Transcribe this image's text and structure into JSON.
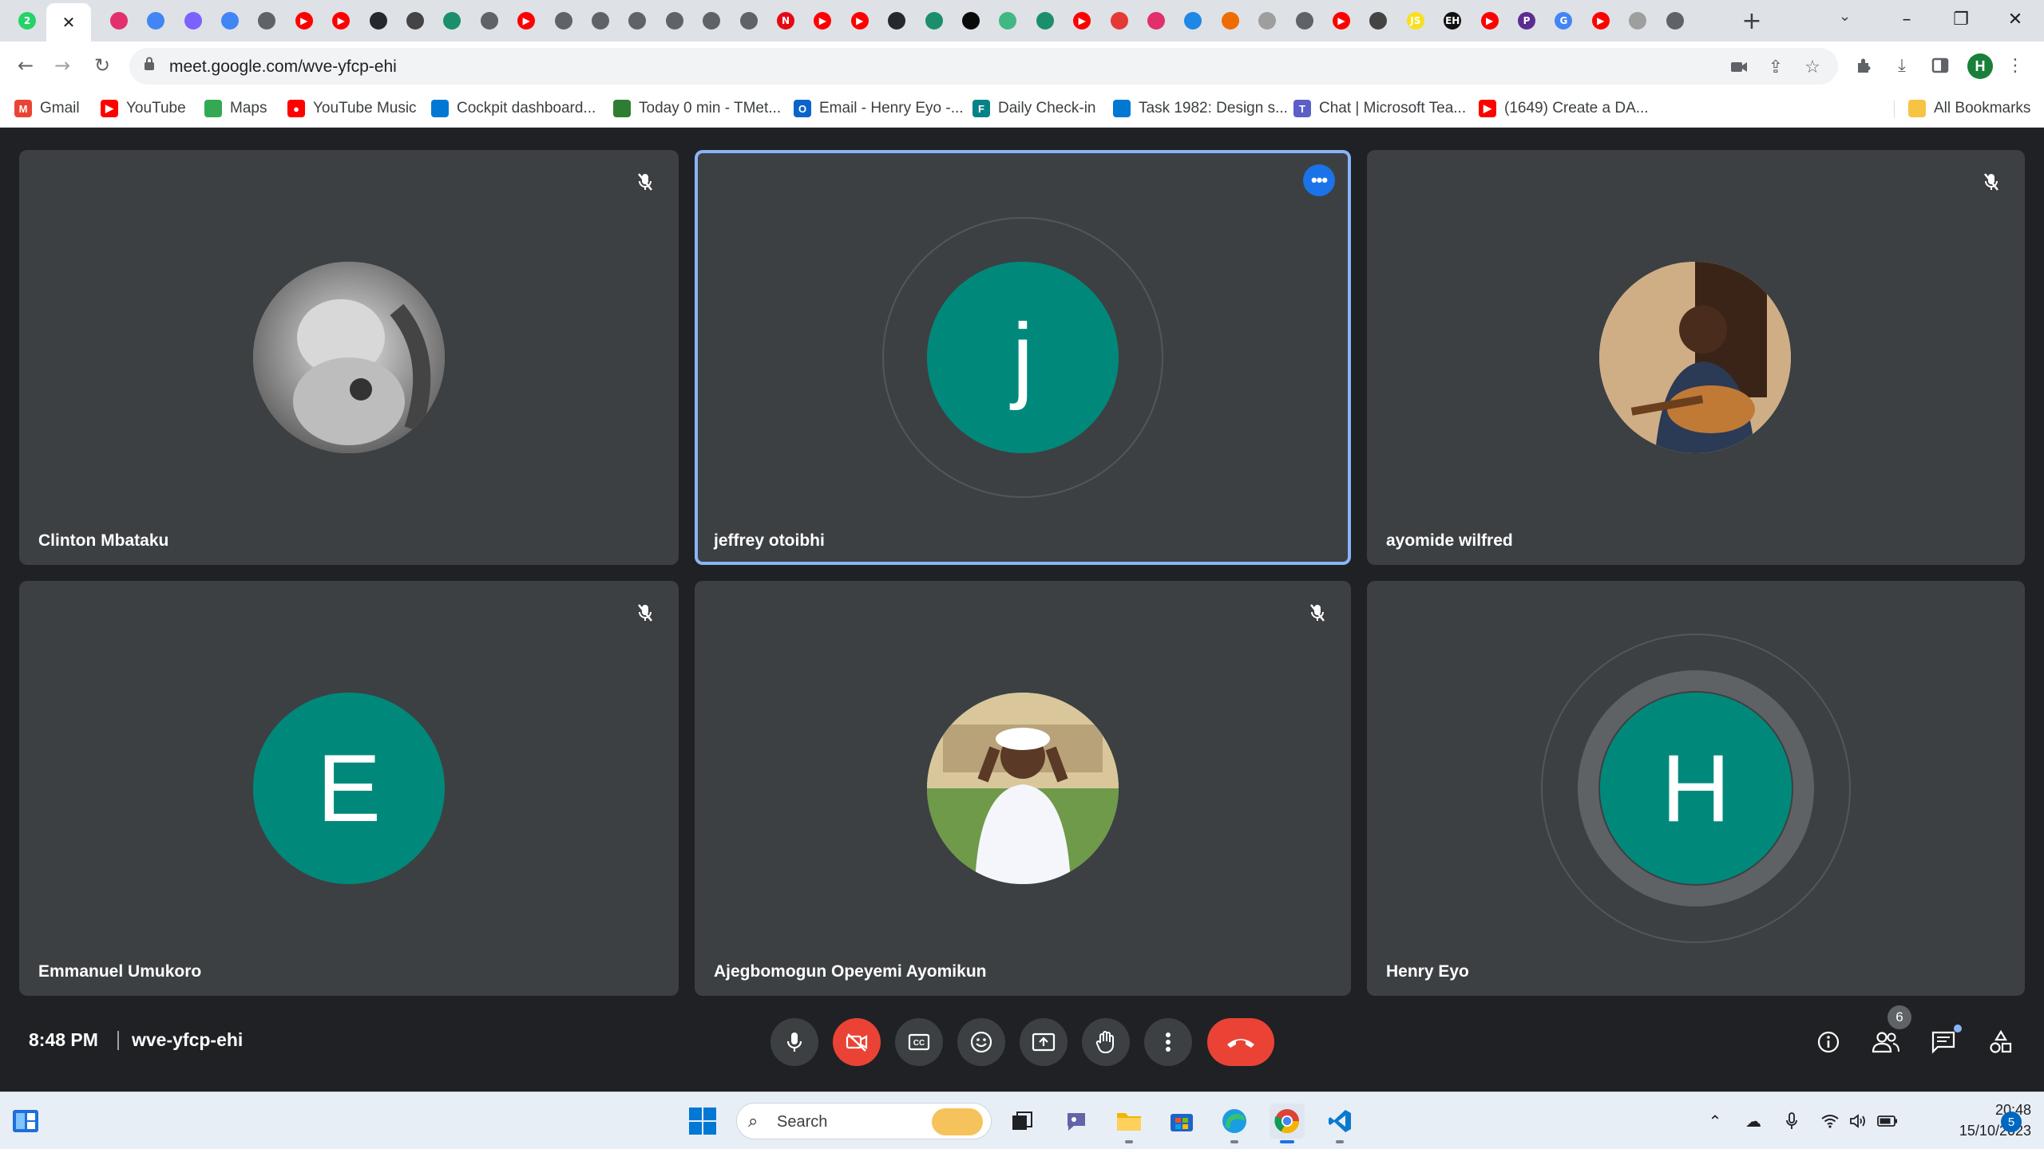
{
  "browser": {
    "url": "meet.google.com/wve-yfcp-ehi",
    "active_tab_close": "✕",
    "new_tab": "+",
    "tab_search": "⌄",
    "window": {
      "minimize": "–",
      "restore": "❐",
      "close": "✕"
    },
    "profile_initial": "H",
    "tab_favicons": [
      {
        "icon": "whatsapp-icon",
        "color": "#25d366",
        "glyph": "2"
      },
      {
        "icon": "globe-icon",
        "color": "#5f6368",
        "glyph": ""
      },
      {
        "icon": "instagram-icon",
        "color": "#e1306c",
        "glyph": ""
      },
      {
        "icon": "google-docs-icon",
        "color": "#4285f4",
        "glyph": ""
      },
      {
        "icon": "figma-icon",
        "color": "#7b61ff",
        "glyph": ""
      },
      {
        "icon": "google-docs-icon",
        "color": "#4285f4",
        "glyph": ""
      },
      {
        "icon": "globe-icon",
        "color": "#5f6368",
        "glyph": ""
      },
      {
        "icon": "youtube-icon",
        "color": "#ff0000",
        "glyph": "▶"
      },
      {
        "icon": "youtube-icon",
        "color": "#ff0000",
        "glyph": "▶"
      },
      {
        "icon": "github-icon",
        "color": "#24292f",
        "glyph": ""
      },
      {
        "icon": "app-icon",
        "color": "#444444",
        "glyph": ""
      },
      {
        "icon": "app-icon",
        "color": "#1b8f6b",
        "glyph": ""
      },
      {
        "icon": "globe-icon",
        "color": "#5f6368",
        "glyph": ""
      },
      {
        "icon": "youtube-icon",
        "color": "#ff0000",
        "glyph": "▶"
      },
      {
        "icon": "globe-icon",
        "color": "#5f6368",
        "glyph": ""
      },
      {
        "icon": "globe-icon",
        "color": "#5f6368",
        "glyph": ""
      },
      {
        "icon": "globe-icon",
        "color": "#5f6368",
        "glyph": ""
      },
      {
        "icon": "globe-icon",
        "color": "#5f6368",
        "glyph": ""
      },
      {
        "icon": "globe-icon",
        "color": "#5f6368",
        "glyph": ""
      },
      {
        "icon": "globe-icon",
        "color": "#5f6368",
        "glyph": ""
      },
      {
        "icon": "netflix-icon",
        "color": "#e50914",
        "glyph": "N"
      },
      {
        "icon": "youtube-icon",
        "color": "#ff0000",
        "glyph": "▶"
      },
      {
        "icon": "youtube-icon",
        "color": "#ff0000",
        "glyph": "▶"
      },
      {
        "icon": "github-icon",
        "color": "#24292f",
        "glyph": ""
      },
      {
        "icon": "app-icon",
        "color": "#1b8f6b",
        "glyph": ""
      },
      {
        "icon": "app-icon",
        "color": "#0a0a0a",
        "glyph": ""
      },
      {
        "icon": "vue-icon",
        "color": "#41b883",
        "glyph": ""
      },
      {
        "icon": "app-icon",
        "color": "#1b8f6b",
        "glyph": ""
      },
      {
        "icon": "youtube-icon",
        "color": "#ff0000",
        "glyph": "▶"
      },
      {
        "icon": "app-icon",
        "color": "#e53935",
        "glyph": ""
      },
      {
        "icon": "instagram-icon",
        "color": "#e1306c",
        "glyph": ""
      },
      {
        "icon": "app-icon",
        "color": "#1e88e5",
        "glyph": ""
      },
      {
        "icon": "app-icon",
        "color": "#ef6c00",
        "glyph": ""
      },
      {
        "icon": "app-icon",
        "color": "#9e9e9e",
        "glyph": ""
      },
      {
        "icon": "globe-icon",
        "color": "#5f6368",
        "glyph": ""
      },
      {
        "icon": "youtube-icon",
        "color": "#ff0000",
        "glyph": "▶"
      },
      {
        "icon": "app-icon",
        "color": "#444444",
        "glyph": ""
      },
      {
        "icon": "app-icon",
        "color": "#f7df1e",
        "glyph": "JS"
      },
      {
        "icon": "app-icon",
        "color": "#111111",
        "glyph": "EH"
      },
      {
        "icon": "youtube-icon",
        "color": "#ff0000",
        "glyph": "▶"
      },
      {
        "icon": "app-icon",
        "color": "#5c2d91",
        "glyph": "P"
      },
      {
        "icon": "google-icon",
        "color": "#4285f4",
        "glyph": "G"
      },
      {
        "icon": "youtube-icon",
        "color": "#ff0000",
        "glyph": "▶"
      },
      {
        "icon": "app-icon",
        "color": "#9e9e9e",
        "glyph": ""
      },
      {
        "icon": "chrome-icon",
        "color": "#5f6368",
        "glyph": ""
      }
    ]
  },
  "bookmarks": [
    {
      "label": "Gmail",
      "icon": "gmail-icon",
      "color": "#ea4335",
      "glyph": "M"
    },
    {
      "label": "YouTube",
      "icon": "youtube-icon",
      "color": "#ff0000",
      "glyph": "▶"
    },
    {
      "label": "Maps",
      "icon": "maps-icon",
      "color": "#34a853",
      "glyph": ""
    },
    {
      "label": "YouTube Music",
      "icon": "youtube-music-icon",
      "color": "#ff0000",
      "glyph": "●"
    },
    {
      "label": "Cockpit dashboard...",
      "icon": "azure-devops-icon",
      "color": "#0078d4",
      "glyph": ""
    },
    {
      "label": "Today 0 min - TMet...",
      "icon": "tmetric-icon",
      "color": "#2e7d32",
      "glyph": ""
    },
    {
      "label": "Email - Henry Eyo -...",
      "icon": "outlook-icon",
      "color": "#0a64c9",
      "glyph": "O"
    },
    {
      "label": "Daily Check-in",
      "icon": "forms-icon",
      "color": "#038387",
      "glyph": "F"
    },
    {
      "label": "Task 1982: Design s...",
      "icon": "azure-devops-icon",
      "color": "#0078d4",
      "glyph": ""
    },
    {
      "label": "Chat | Microsoft Tea...",
      "icon": "teams-icon",
      "color": "#5b5fc7",
      "glyph": "T"
    },
    {
      "label": "(1649) Create a DA...",
      "icon": "youtube-icon",
      "color": "#ff0000",
      "glyph": "▶"
    }
  ],
  "all_bookmarks": "All Bookmarks",
  "participants": [
    {
      "name": "Clinton Mbataku",
      "muted": true,
      "avatar": "photo",
      "active": false
    },
    {
      "name": "jeffrey otoibhi",
      "muted": false,
      "avatar": "j",
      "active": true
    },
    {
      "name": "ayomide wilfred",
      "muted": true,
      "avatar": "photo",
      "active": false
    },
    {
      "name": "Emmanuel Umukoro",
      "muted": true,
      "avatar": "E",
      "active": false
    },
    {
      "name": "Ajegbomogun Opeyemi Ayomikun",
      "muted": true,
      "avatar": "photo",
      "active": false
    },
    {
      "name": "Henry Eyo",
      "muted": false,
      "avatar": "H",
      "active": false
    }
  ],
  "more_options_glyph": "•••",
  "meeting": {
    "time": "8:48 PM",
    "code": "wve-yfcp-ehi",
    "people_count": "6"
  },
  "taskbar": {
    "search_label": "Search",
    "clock_time": "20:48",
    "clock_date": "15/10/2023",
    "notification_count": "5"
  },
  "colors": {
    "accent_teal": "#00897b",
    "leave_red": "#ea4335",
    "active_border": "#8ab4f8",
    "tile_bg": "#3c4043",
    "stage_bg": "#202124"
  }
}
